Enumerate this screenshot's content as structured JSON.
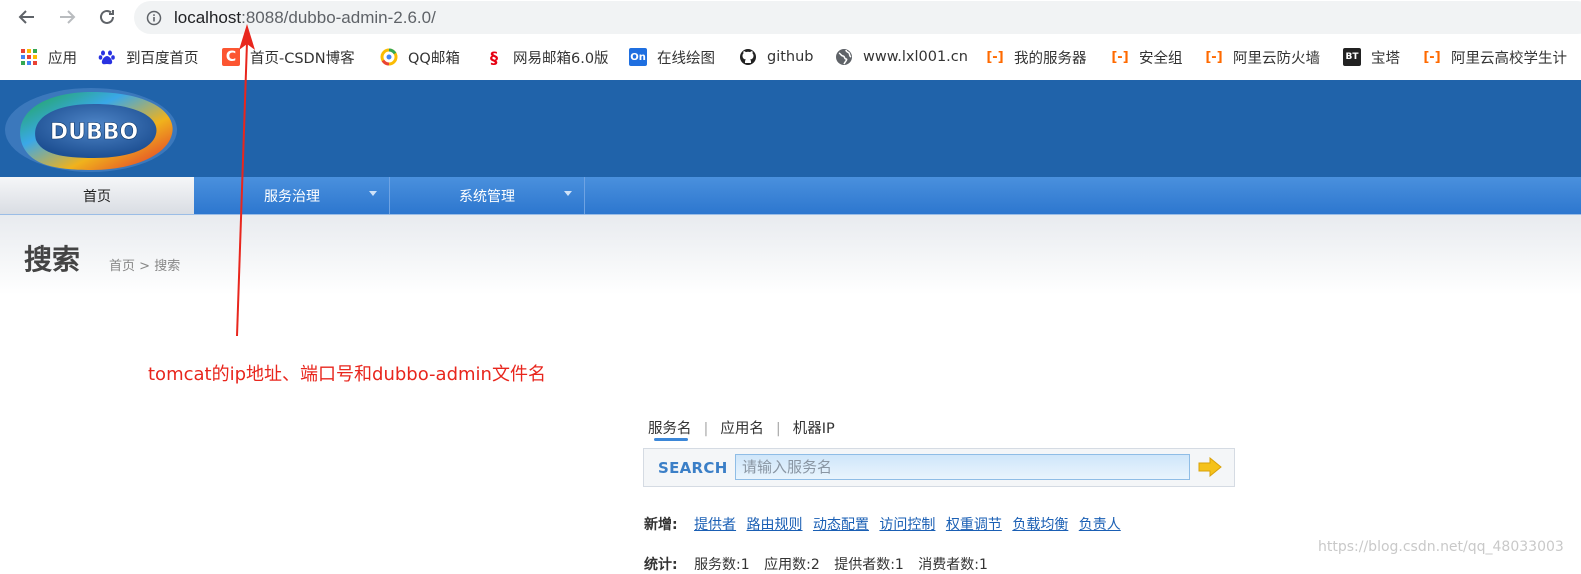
{
  "browser": {
    "url_host": "localhost",
    "url_rest": ":8088/dubbo-admin-2.6.0/",
    "bookmarks": [
      {
        "label": "应用",
        "icon": "apps-grid-icon"
      },
      {
        "label": "到百度首页",
        "icon": "baidu-paw-icon"
      },
      {
        "label": "首页-CSDN博客",
        "icon": "csdn-c-icon"
      },
      {
        "label": "QQ邮箱",
        "icon": "qq-mail-icon"
      },
      {
        "label": "网易邮箱6.0版",
        "icon": "netease-mail-icon"
      },
      {
        "label": "在线绘图",
        "icon": "on-drawing-icon"
      },
      {
        "label": "github",
        "icon": "github-octocat-icon"
      },
      {
        "label": "www.lxl001.cn",
        "icon": "globe-icon"
      },
      {
        "label": "我的服务器",
        "icon": "aliyun-bracket-icon"
      },
      {
        "label": "安全组",
        "icon": "aliyun-bracket-icon"
      },
      {
        "label": "阿里云防火墙",
        "icon": "aliyun-bracket-icon"
      },
      {
        "label": "宝塔",
        "icon": "bt-panel-icon"
      },
      {
        "label": "阿里云高校学生计",
        "icon": "aliyun-bracket-icon"
      }
    ]
  },
  "header": {
    "logo_text": "DUBBO",
    "menu": [
      {
        "label": "首页",
        "active": true
      },
      {
        "label": "服务治理",
        "dropdown": true
      },
      {
        "label": "系统管理",
        "dropdown": true
      }
    ]
  },
  "page": {
    "title": "搜索",
    "breadcrumb_home": "首页",
    "breadcrumb_sep": " > ",
    "breadcrumb_current": "搜索"
  },
  "annotation": {
    "text": "tomcat的ip地址、端口号和dubbo-admin文件名",
    "color": "#e8261d"
  },
  "search": {
    "tabs": [
      "服务名",
      "应用名",
      "机器IP"
    ],
    "tab_sep": "|",
    "label": "SEARCH",
    "placeholder": "请输入服务名"
  },
  "add_links": {
    "label": "新增:",
    "links": [
      "提供者",
      "路由规则",
      "动态配置",
      "访问控制",
      "权重调节",
      "负载均衡",
      "负责人"
    ]
  },
  "stats": {
    "label": "统计:",
    "items": [
      "服务数:1",
      "应用数:2",
      "提供者数:1",
      "消费者数:1"
    ]
  },
  "watermark": "https://blog.csdn.net/qq_48033003",
  "colors": {
    "banner": "#2063aa",
    "menubar": "#2d77cf",
    "link": "#1a5fb4",
    "search_label": "#3b7fc7"
  }
}
